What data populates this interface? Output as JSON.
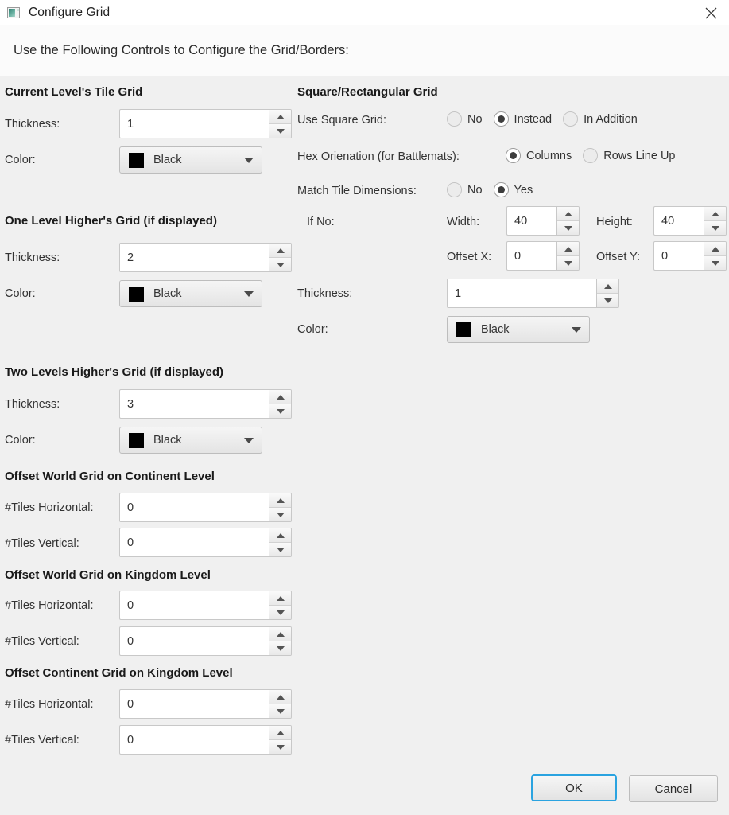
{
  "window": {
    "title": "Configure Grid",
    "icon": "grid-app-icon",
    "close_icon": "close-icon"
  },
  "banner": {
    "text": "Use the Following Controls to Configure the Grid/Borders:"
  },
  "labels": {
    "thickness": "Thickness:",
    "color": "Color:",
    "tiles_horizontal": "#Tiles Horizontal:",
    "tiles_vertical": "#Tiles Vertical:",
    "use_square_grid": "Use Square Grid:",
    "hex_orientation": "Hex Orienation (for Battlemats):",
    "match_tile_dimensions": "Match Tile Dimensions:",
    "if_no": "If No:",
    "width": "Width:",
    "height": "Height:",
    "offset_x": "Offset X:",
    "offset_y": "Offset Y:"
  },
  "left_column": {
    "current_level": {
      "title": "Current Level's Tile Grid",
      "thickness": "1",
      "color": "Black",
      "color_hex": "#000000"
    },
    "one_level_higher": {
      "title": "One Level Higher's Grid (if displayed)",
      "thickness": "2",
      "color": "Black",
      "color_hex": "#000000"
    },
    "two_levels_higher": {
      "title": "Two Levels Higher's Grid (if displayed)",
      "thickness": "3",
      "color": "Black",
      "color_hex": "#000000"
    },
    "offset_world_continent": {
      "title": "Offset World Grid on Continent Level",
      "tiles_horizontal": "0",
      "tiles_vertical": "0"
    },
    "offset_world_kingdom": {
      "title": "Offset World Grid on Kingdom Level",
      "tiles_horizontal": "0",
      "tiles_vertical": "0"
    },
    "offset_continent_kingdom": {
      "title": "Offset Continent Grid on Kingdom Level",
      "tiles_horizontal": "0",
      "tiles_vertical": "0"
    }
  },
  "right_column": {
    "title": "Square/Rectangular Grid",
    "use_square_grid": {
      "options": [
        "No",
        "Instead",
        "In Addition"
      ],
      "selected": "Instead"
    },
    "hex_orientation": {
      "options": [
        "Columns",
        "Rows Line Up"
      ],
      "selected": "Columns"
    },
    "match_tile_dimensions": {
      "options": [
        "No",
        "Yes"
      ],
      "selected": "Yes"
    },
    "dimensions": {
      "width": "40",
      "height": "40",
      "offset_x": "0",
      "offset_y": "0"
    },
    "thickness": "1",
    "color": "Black",
    "color_hex": "#000000"
  },
  "footer": {
    "ok": "OK",
    "cancel": "Cancel",
    "focus_color": "#2aa3e0"
  }
}
